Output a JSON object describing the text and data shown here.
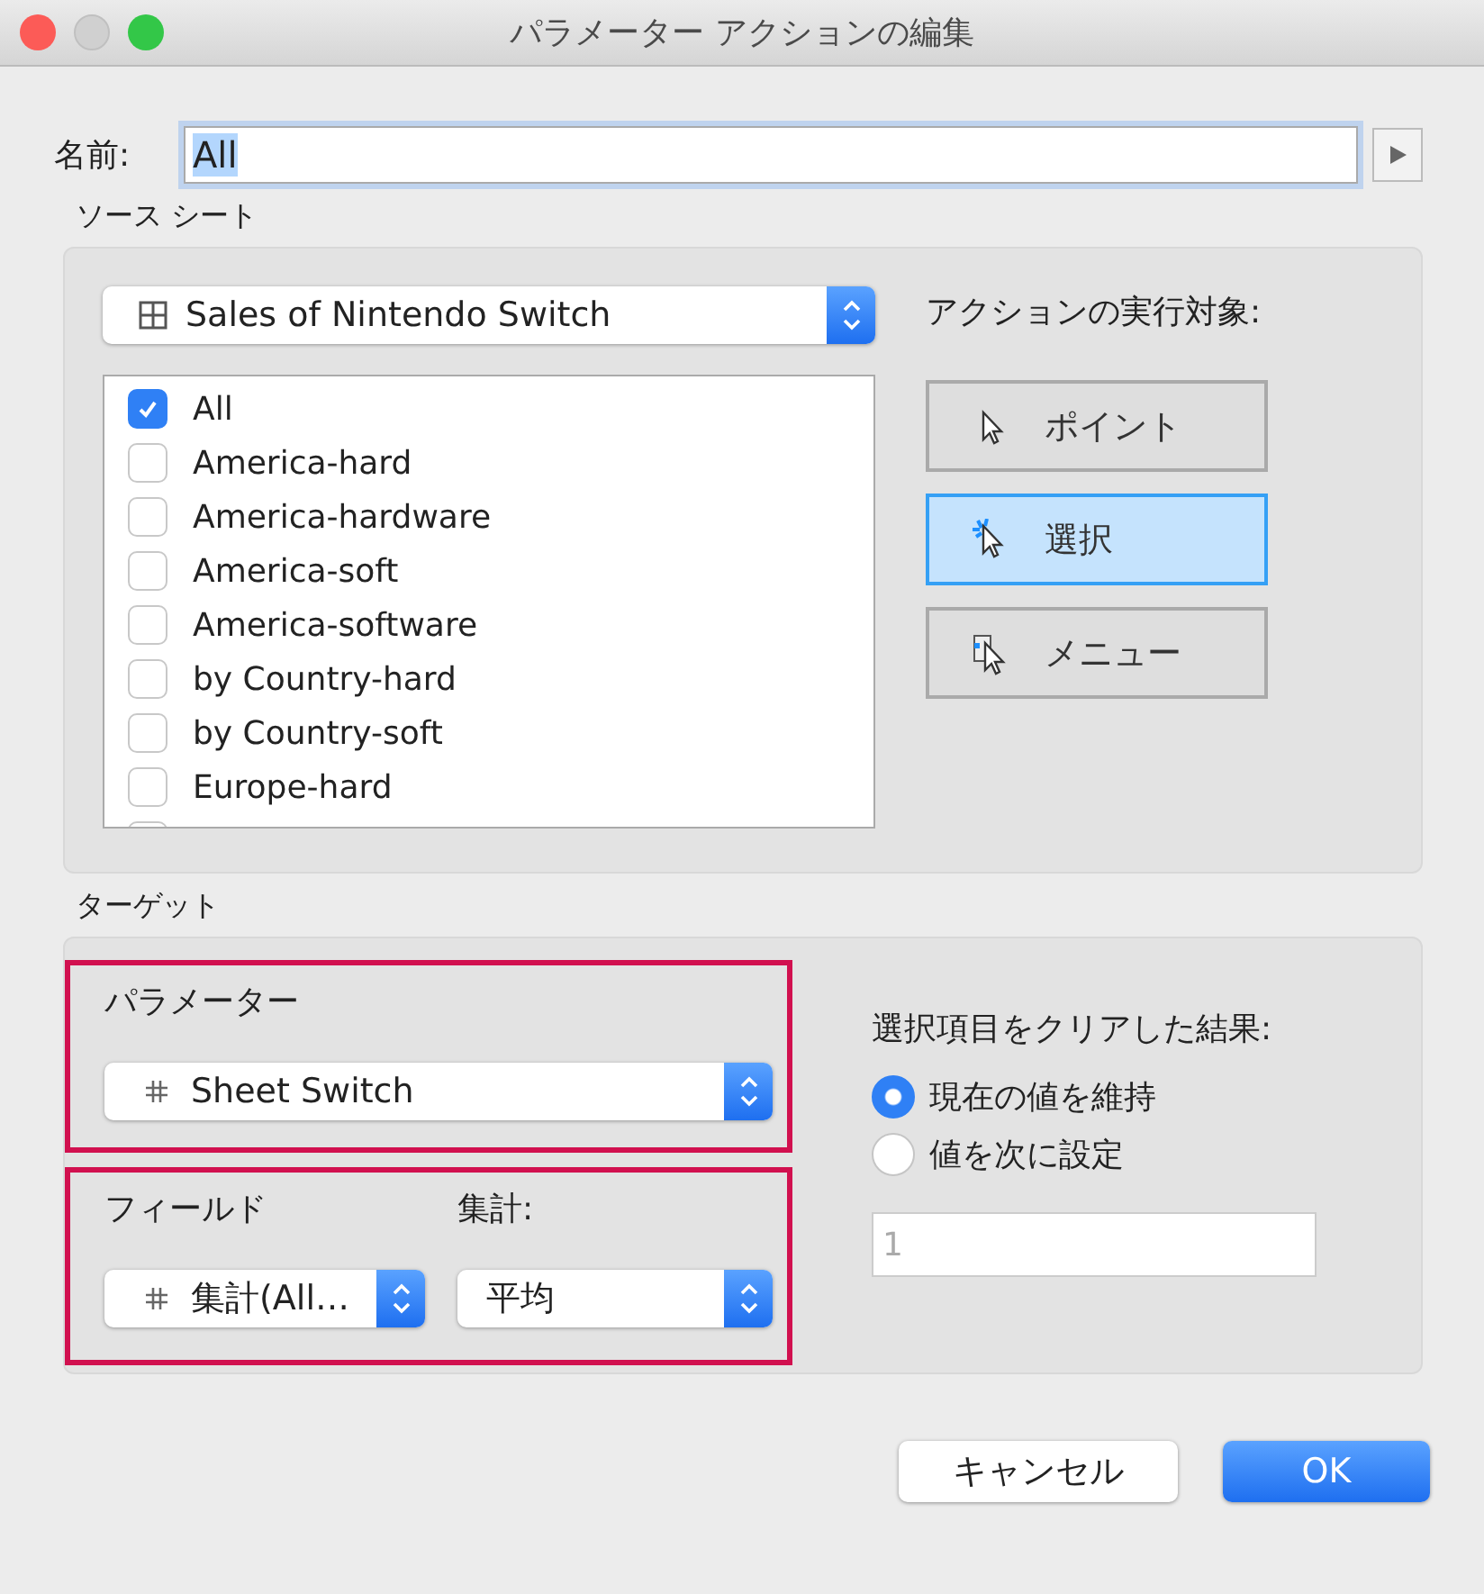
{
  "window": {
    "title": "パラメーター アクションの編集"
  },
  "name": {
    "label": "名前:",
    "value": "All",
    "selected_text": true
  },
  "source": {
    "label": "ソース シート",
    "sheet": "Sales of Nintendo Switch",
    "sheets": [
      {
        "label": "All",
        "checked": true
      },
      {
        "label": "America-hard",
        "checked": false
      },
      {
        "label": "America-hardware",
        "checked": false
      },
      {
        "label": "America-soft",
        "checked": false
      },
      {
        "label": "America-software",
        "checked": false
      },
      {
        "label": "by Country-hard",
        "checked": false
      },
      {
        "label": "by Country-soft",
        "checked": false
      },
      {
        "label": "Europe-hard",
        "checked": false
      }
    ],
    "run_on_label": "アクションの実行対象:",
    "run_on": [
      {
        "kind": "point",
        "label": "ポイント",
        "selected": false
      },
      {
        "kind": "select",
        "label": "選択",
        "selected": true
      },
      {
        "kind": "menu",
        "label": "メニュー",
        "selected": false
      }
    ]
  },
  "target": {
    "label": "ターゲット",
    "parameter": {
      "label": "パラメーター",
      "value": "Sheet Switch",
      "highlighted": true
    },
    "field": {
      "label": "フィールド",
      "value": "集計(All…",
      "highlighted": true
    },
    "aggregation": {
      "label": "集計:",
      "value": "平均"
    },
    "clear_label": "選択項目をクリアした結果:",
    "clear_options": [
      {
        "label": "現在の値を維持",
        "selected": true
      },
      {
        "label": "値を次に設定",
        "selected": false
      }
    ],
    "clear_value": {
      "value": "1",
      "disabled": true
    }
  },
  "buttons": [
    {
      "kind": "cancel",
      "label": "キャンセル"
    },
    {
      "kind": "ok",
      "label": "OK"
    }
  ]
}
